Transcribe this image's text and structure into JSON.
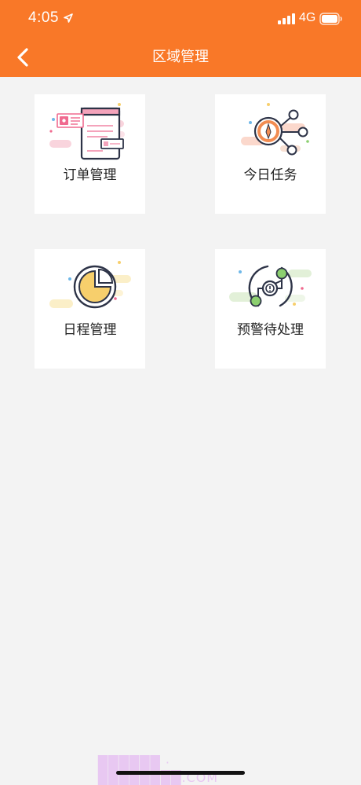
{
  "status_bar": {
    "time": "4:05",
    "network": "4G"
  },
  "nav": {
    "title": "区域管理"
  },
  "cards": [
    {
      "label": "订单管理"
    },
    {
      "label": "今日任务"
    },
    {
      "label": "日程管理"
    },
    {
      "label": "预警待处理"
    }
  ],
  "watermark": "██████ · ████████.COM",
  "colors": {
    "header": "#f97828",
    "background": "#f3f3f3",
    "card": "#ffffff",
    "accent_pink": "#f06a8f",
    "accent_orange": "#f28c52",
    "accent_yellow": "#f7cf6c",
    "accent_green": "#8ccf6f",
    "outline": "#2d3347"
  },
  "icons": {
    "back": "chevron-left-icon",
    "orders": "order-document-icon",
    "today": "task-network-icon",
    "schedule": "pie-chart-icon",
    "warning": "warning-cycle-icon"
  }
}
